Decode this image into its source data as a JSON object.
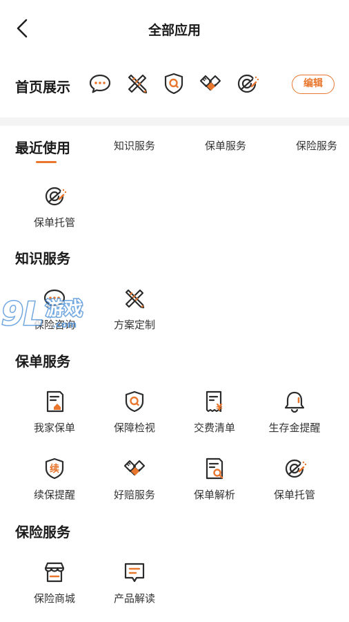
{
  "header": {
    "title": "全部应用"
  },
  "home_display": {
    "label": "首页展示",
    "icons": [
      "chat-bubble-icon",
      "pencil-ruler-icon",
      "shield-search-icon",
      "handshake-icon",
      "policy-swirl-icon"
    ],
    "edit_label": "编辑"
  },
  "tabs": [
    {
      "label": "最近使用",
      "active": true
    },
    {
      "label": "知识服务",
      "active": false
    },
    {
      "label": "保单服务",
      "active": false
    },
    {
      "label": "保险服务",
      "active": false
    }
  ],
  "recent": {
    "items": [
      {
        "label": "保单托管",
        "icon": "policy-swirl-icon"
      }
    ]
  },
  "knowledge": {
    "title": "知识服务",
    "items": [
      {
        "label": "保险咨询",
        "icon": "chat-bubble-icon"
      },
      {
        "label": "方案定制",
        "icon": "pencil-ruler-icon"
      }
    ]
  },
  "policy": {
    "title": "保单服务",
    "items": [
      {
        "label": "我家保单",
        "icon": "document-house-icon"
      },
      {
        "label": "保障检视",
        "icon": "shield-search-icon"
      },
      {
        "label": "交费清单",
        "icon": "bill-yuan-icon"
      },
      {
        "label": "生存金提醒",
        "icon": "bell-icon"
      },
      {
        "label": "续保提醒",
        "icon": "renew-shield-icon"
      },
      {
        "label": "好赔服务",
        "icon": "handshake-icon"
      },
      {
        "label": "保单解析",
        "icon": "document-search-icon"
      },
      {
        "label": "保单托管",
        "icon": "policy-swirl-icon"
      }
    ]
  },
  "insurance": {
    "title": "保险服务",
    "items": [
      {
        "label": "保险商城",
        "icon": "store-icon"
      },
      {
        "label": "产品解读",
        "icon": "message-note-icon"
      }
    ]
  },
  "watermark": {
    "text": "9L游戏",
    "sub": ".com"
  },
  "colors": {
    "accent": "#e8762d",
    "icon_stroke": "#2b2b2b",
    "divider": "#f4f4f4"
  }
}
